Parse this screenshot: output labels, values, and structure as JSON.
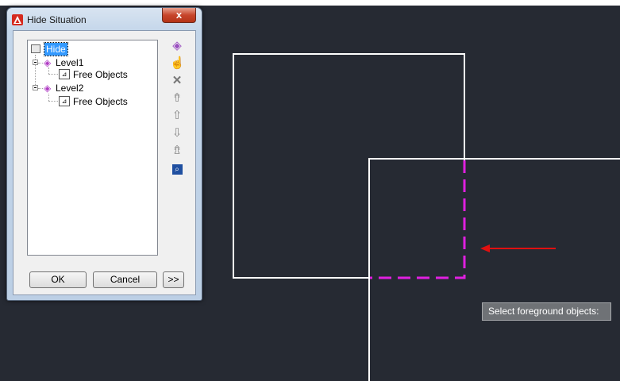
{
  "dialog": {
    "title": "Hide Situation",
    "close_label": "x",
    "tree": {
      "root": "Hide",
      "levels": [
        {
          "label": "Level1",
          "child": "Free Objects"
        },
        {
          "label": "Level2",
          "child": "Free Objects"
        }
      ]
    },
    "tools": [
      {
        "icon": "new-level-icon"
      },
      {
        "icon": "select-objects-icon"
      },
      {
        "icon": "delete-icon"
      },
      {
        "icon": "move-top-icon"
      },
      {
        "icon": "move-up-icon"
      },
      {
        "icon": "move-down-icon"
      },
      {
        "icon": "move-bottom-icon"
      },
      {
        "icon": "zoom-preview-icon"
      }
    ],
    "buttons": {
      "ok": "OK",
      "cancel": "Cancel",
      "more": ">>"
    }
  },
  "canvas": {
    "prompt_tooltip": "Select foreground objects:",
    "colors": {
      "background": "#262a33",
      "lines": "#ffffff",
      "hidden_dashed": "#e020e0",
      "arrow": "#e01010"
    }
  }
}
